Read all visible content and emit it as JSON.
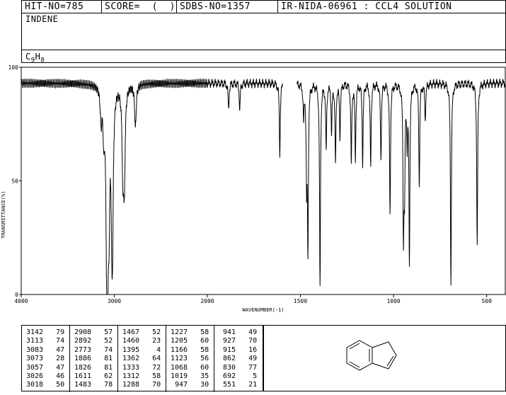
{
  "header": {
    "hit_no": "HIT-NO=785",
    "score": "SCORE=  (  )",
    "sdbs_no": "SDBS-NO=1357",
    "ir_info": "IR-NIDA-06961 : CCL4 SOLUTION"
  },
  "compound": {
    "name": "INDENE",
    "formula_c": "C",
    "formula_c_sub": "9",
    "formula_h": "H",
    "formula_h_sub": "8"
  },
  "chart_data": {
    "type": "line",
    "xlabel": "WAVENUMBER(-1)",
    "ylabel": "TRANSMITTANCE(%)",
    "xlim": [
      4000,
      400
    ],
    "ylim": [
      0,
      100
    ],
    "x_ticks": [
      4000,
      3000,
      2000,
      1500,
      1000,
      500
    ],
    "y_ticks": [
      100,
      50,
      0
    ],
    "x_tick_labels": [
      "4000",
      "3000",
      "2000",
      "1500",
      "1000",
      "500"
    ],
    "y_tick_labels": [
      "100",
      "50",
      "0"
    ],
    "baseline": 93,
    "gaps": [
      [
        1595,
        1520
      ]
    ],
    "peaks": [
      [
        3142,
        79
      ],
      [
        3113,
        74
      ],
      [
        3083,
        47
      ],
      [
        3073,
        28
      ],
      [
        3057,
        47
      ],
      [
        3026,
        46
      ],
      [
        3018,
        50
      ],
      [
        2908,
        57
      ],
      [
        2892,
        52
      ],
      [
        2773,
        74
      ],
      [
        1886,
        81
      ],
      [
        1826,
        81
      ],
      [
        1611,
        62
      ],
      [
        1483,
        78
      ],
      [
        1467,
        52
      ],
      [
        1460,
        23
      ],
      [
        1395,
        4
      ],
      [
        1362,
        64
      ],
      [
        1333,
        72
      ],
      [
        1312,
        58
      ],
      [
        1288,
        70
      ],
      [
        1227,
        58
      ],
      [
        1205,
        60
      ],
      [
        1166,
        58
      ],
      [
        1123,
        56
      ],
      [
        1068,
        60
      ],
      [
        1019,
        35
      ],
      [
        947,
        30
      ],
      [
        941,
        49
      ],
      [
        927,
        70
      ],
      [
        915,
        16
      ],
      [
        862,
        49
      ],
      [
        830,
        77
      ],
      [
        692,
        5
      ],
      [
        551,
        21
      ]
    ]
  },
  "peak_table": [
    [
      [
        "3142",
        "79"
      ],
      [
        "3113",
        "74"
      ],
      [
        "3083",
        "47"
      ],
      [
        "3073",
        "28"
      ],
      [
        "3057",
        "47"
      ],
      [
        "3026",
        "46"
      ],
      [
        "3018",
        "50"
      ]
    ],
    [
      [
        "2908",
        "57"
      ],
      [
        "2892",
        "52"
      ],
      [
        "2773",
        "74"
      ],
      [
        "1886",
        "81"
      ],
      [
        "1826",
        "81"
      ],
      [
        "1611",
        "62"
      ],
      [
        "1483",
        "78"
      ]
    ],
    [
      [
        "1467",
        "52"
      ],
      [
        "1460",
        "23"
      ],
      [
        "1395",
        "4"
      ],
      [
        "1362",
        "64"
      ],
      [
        "1333",
        "72"
      ],
      [
        "1312",
        "58"
      ],
      [
        "1288",
        "70"
      ]
    ],
    [
      [
        "1227",
        "58"
      ],
      [
        "1205",
        "60"
      ],
      [
        "1166",
        "58"
      ],
      [
        "1123",
        "56"
      ],
      [
        "1068",
        "60"
      ],
      [
        "1019",
        "35"
      ],
      [
        "947",
        "30"
      ]
    ],
    [
      [
        "941",
        "49"
      ],
      [
        "927",
        "70"
      ],
      [
        "915",
        "16"
      ],
      [
        "862",
        "49"
      ],
      [
        "830",
        "77"
      ],
      [
        "692",
        "5"
      ],
      [
        "551",
        "21"
      ]
    ]
  ]
}
